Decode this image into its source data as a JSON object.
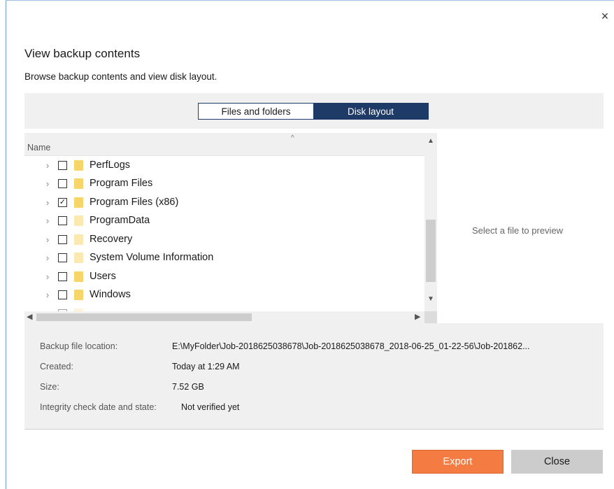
{
  "window": {
    "close_glyph": "×"
  },
  "dialog": {
    "title": "View backup contents",
    "subtitle": "Browse backup contents and view disk layout."
  },
  "tabs": [
    {
      "label": "Files and folders",
      "active": false
    },
    {
      "label": "Disk layout",
      "active": true
    }
  ],
  "tree": {
    "column_header": "Name",
    "sort_glyph": "^",
    "rows": [
      {
        "label": "PerfLogs",
        "checked": false,
        "check_glyph": "",
        "folder_style": "normal"
      },
      {
        "label": "Program Files",
        "checked": false,
        "check_glyph": "",
        "folder_style": "normal"
      },
      {
        "label": "Program Files (x86)",
        "checked": true,
        "check_glyph": "✓",
        "folder_style": "normal"
      },
      {
        "label": "ProgramData",
        "checked": false,
        "check_glyph": "",
        "folder_style": "pale"
      },
      {
        "label": "Recovery",
        "checked": false,
        "check_glyph": "",
        "folder_style": "pale"
      },
      {
        "label": "System Volume Information",
        "checked": false,
        "check_glyph": "",
        "folder_style": "pale"
      },
      {
        "label": "Users",
        "checked": false,
        "check_glyph": "",
        "folder_style": "normal"
      },
      {
        "label": "Windows",
        "checked": false,
        "check_glyph": "",
        "folder_style": "normal"
      }
    ],
    "chevron_glyph": "›"
  },
  "scrollbars": {
    "up_glyph": "▲",
    "down_glyph": "▼",
    "left_glyph": "◀",
    "right_glyph": "▶"
  },
  "preview": {
    "placeholder": "Select a file to preview"
  },
  "info": {
    "location_label": "Backup file location:",
    "location_value": "E:\\MyFolder\\Job-2018625038678\\Job-2018625038678_2018-06-25_01-22-56\\Job-201862...",
    "created_label": "Created:",
    "created_value": "Today at 1:29 AM",
    "size_label": "Size:",
    "size_value": "7.52 GB",
    "integrity_label": "Integrity check date and state:",
    "integrity_value": "Not verified yet"
  },
  "buttons": {
    "export_label": "Export",
    "close_label": "Close"
  },
  "colors": {
    "accent_navy": "#1e3a66",
    "export_orange": "#f47c42",
    "folder_yellow": "#f8d569"
  }
}
